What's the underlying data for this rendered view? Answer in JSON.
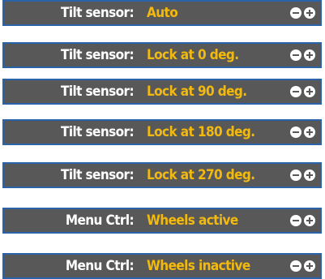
{
  "rows": [
    {
      "label": "Tilt sensor:",
      "value": "Auto"
    },
    {
      "label": "Tilt sensor:",
      "value": "Lock at 0 deg."
    },
    {
      "label": "Tilt sensor:",
      "value": "Lock at 90 deg."
    },
    {
      "label": "Tilt sensor:",
      "value": "Lock at 180 deg."
    },
    {
      "label": "Tilt sensor:",
      "value": "Lock at 270 deg."
    },
    {
      "label": "Menu Ctrl:",
      "value": "Wheels active"
    },
    {
      "label": "Menu Ctrl:",
      "value": "Wheels inactive"
    }
  ],
  "colors": {
    "row_background": "#585858",
    "row_border": "#2a63a8",
    "label_text": "#ffffff",
    "value_text": "#f2b90f"
  },
  "icons": {
    "decrease": "minus-circle-icon",
    "increase": "plus-circle-icon"
  }
}
